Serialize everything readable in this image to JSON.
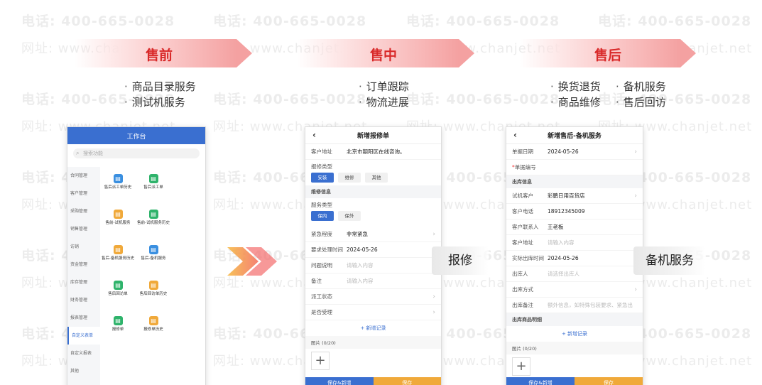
{
  "watermark": {
    "line1": "电话: 400-665-0028",
    "line2": "网址: www.chanjet.net"
  },
  "phases": [
    {
      "label": "售前",
      "bullets": [
        "商品目录服务",
        "测试机服务"
      ]
    },
    {
      "label": "售中",
      "bullets": [
        "订单跟踪",
        "物流进展"
      ]
    },
    {
      "label": "售后",
      "bullets": [
        "换货退货",
        "备机服务",
        "商品维修",
        "售后回访"
      ]
    }
  ],
  "screen1": {
    "title": "工作台",
    "search_placeholder": "搜索功能",
    "sidebar": [
      "合同管理",
      "客户管理",
      "采购管理",
      "销售管理",
      "访销",
      "资金管理",
      "库存管理",
      "财务管理",
      "报表管理",
      "自定义表单",
      "自定义报表",
      "其他"
    ],
    "tiles": [
      {
        "label": "售后派工单历史",
        "color": "#3a8fe0"
      },
      {
        "label": "售后派工单",
        "color": "#2fb36b"
      },
      {
        "label": "售前-试机服务",
        "color": "#f0a93a"
      },
      {
        "label": "售前-试机服务历史",
        "color": "#2fb36b"
      },
      {
        "label": "售后-备机服务历史",
        "color": "#f0a93a"
      },
      {
        "label": "售后-备机服务",
        "color": "#3a8fe0"
      },
      {
        "label": "售后回访单",
        "color": "#2fb36b"
      },
      {
        "label": "售后回访单历史",
        "color": "#f0a93a"
      },
      {
        "label": "报修单",
        "color": "#2fb36b"
      },
      {
        "label": "报修单历史",
        "color": "#f0a93a"
      }
    ]
  },
  "screen2": {
    "title": "新增报修单",
    "customer_address_label": "客户地址",
    "customer_address_value": "北京市朝阳区在线咨询。",
    "repair_type_label": "报修类型",
    "repair_type_options": [
      "安装",
      "维修",
      "其他"
    ],
    "section_repair_info": "维修信息",
    "service_type_label": "服务类型",
    "service_type_options": [
      "保内",
      "保外"
    ],
    "urgency_label": "紧急程度",
    "urgency_value": "非常紧急",
    "deadline_label": "要求处理时间",
    "deadline_value": "2024-05-26",
    "issue_label": "问题说明",
    "issue_placeholder": "请输入内容",
    "remark_label": "备注",
    "remark_placeholder": "请输入内容",
    "dispatch_label": "派工状态",
    "accept_label": "是否受理",
    "add_record": "新增记录",
    "photo_label": "图片 (0/20)",
    "btn_save_new": "保存&新增",
    "btn_save": "保存"
  },
  "screen3": {
    "title": "新增售后-备机服务",
    "date_label": "单据日期",
    "date_value": "2024-05-26",
    "number_label": "单据编号",
    "section_out": "出库信息",
    "trial_customer_label": "试机客户",
    "trial_customer_value": "彩鹏日用百货店",
    "phone_label": "客户电话",
    "phone_value": "18912345009",
    "contact_label": "客户联系人",
    "contact_value": "王老板",
    "address_label": "客户地址",
    "address_placeholder": "请输入内容",
    "out_time_label": "实际出库时间",
    "out_time_value": "2024-05-26",
    "out_person_label": "出库人",
    "out_person_placeholder": "请选择出库人",
    "out_method_label": "出库方式",
    "out_remark_label": "出库备注",
    "out_remark_placeholder": "额外信息，如特殊包装要求、紧急出",
    "section_goods": "出库商品明细",
    "add_record": "新增记录",
    "photo_label": "图片 (0/20)",
    "btn_save_new": "保存&新增",
    "btn_save": "保存"
  },
  "tags": {
    "repair": "报修",
    "backup": "备机服务"
  }
}
